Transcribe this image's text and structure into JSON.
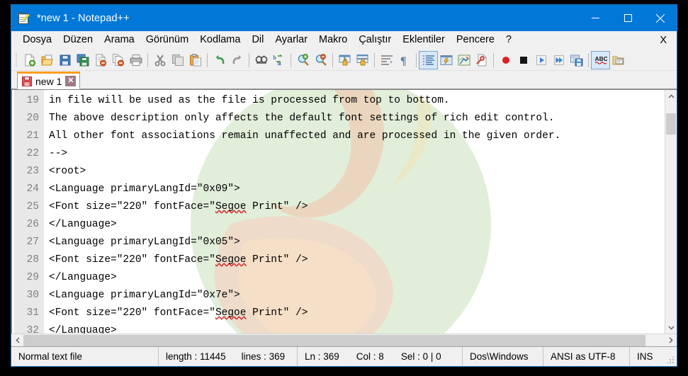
{
  "window": {
    "title": "*new  1 - Notepad++",
    "icon": "notepad-plus-plus-icon",
    "accent_color": "#0078d7",
    "controls": {
      "minimize": "minimize-icon",
      "maximize": "maximize-icon",
      "close": "close-icon"
    }
  },
  "menu": {
    "items": [
      {
        "label": "Dosya"
      },
      {
        "label": "Düzen"
      },
      {
        "label": "Arama"
      },
      {
        "label": "Görünüm"
      },
      {
        "label": "Kodlama"
      },
      {
        "label": "Dil"
      },
      {
        "label": "Ayarlar"
      },
      {
        "label": "Makro"
      },
      {
        "label": "Çalıştır"
      },
      {
        "label": "Eklentiler"
      },
      {
        "label": "Pencere"
      },
      {
        "label": "?"
      }
    ],
    "right_label": "X"
  },
  "toolbar": {
    "buttons": [
      {
        "name": "new-file-icon"
      },
      {
        "name": "open-file-icon"
      },
      {
        "name": "save-icon"
      },
      {
        "name": "save-all-icon"
      },
      {
        "name": "close-file-icon"
      },
      {
        "name": "close-all-files-icon"
      },
      {
        "name": "print-icon"
      },
      {
        "name": "cut-icon"
      },
      {
        "name": "copy-icon"
      },
      {
        "name": "paste-icon"
      },
      {
        "name": "undo-icon"
      },
      {
        "name": "redo-icon"
      },
      {
        "name": "find-icon"
      },
      {
        "name": "replace-icon"
      },
      {
        "name": "zoom-in-icon"
      },
      {
        "name": "zoom-out-icon"
      },
      {
        "name": "sync-vertical-scrolling-icon"
      },
      {
        "name": "sync-horizontal-scrolling-icon"
      },
      {
        "name": "word-wrap-icon"
      },
      {
        "name": "show-all-characters-icon"
      },
      {
        "name": "show-indent-guide-icon"
      },
      {
        "name": "user-defined-language-icon"
      },
      {
        "name": "document-map-icon"
      },
      {
        "name": "function-list-icon"
      },
      {
        "name": "start-record-macro-icon"
      },
      {
        "name": "stop-record-macro-icon"
      },
      {
        "name": "play-macro-icon"
      },
      {
        "name": "run-macro-multiple-times-icon"
      },
      {
        "name": "save-macro-icon"
      },
      {
        "name": "spell-check-icon"
      },
      {
        "name": "file-browser-icon"
      }
    ]
  },
  "tabs": [
    {
      "label": "new 1",
      "icon": "unsaved-file-icon",
      "close_label": "✕",
      "active": true,
      "modified": true
    }
  ],
  "editor": {
    "first_line_number": 19,
    "lines": [
      {
        "num": 19,
        "text": "in file will be used as the file is processed from top to bottom."
      },
      {
        "num": 20,
        "text": "The above description only affects the default font settings of rich edit control."
      },
      {
        "num": 21,
        "text": "All other font associations remain unaffected and are processed in the given order."
      },
      {
        "num": 22,
        "text": "-->"
      },
      {
        "num": 23,
        "text": "<root>"
      },
      {
        "num": 24,
        "text": "<Language primaryLangId=\"0x09\">"
      },
      {
        "num": 25,
        "text": "<Font size=\"220\" fontFace=\"Segoe Print\" />",
        "misspelled": "Segoe"
      },
      {
        "num": 26,
        "text": "</Language>"
      },
      {
        "num": 27,
        "text": "<Language primaryLangId=\"0x05\">"
      },
      {
        "num": 28,
        "text": "<Font size=\"220\" fontFace=\"Segoe Print\" />",
        "misspelled": "Segoe"
      },
      {
        "num": 29,
        "text": "</Language>"
      },
      {
        "num": 30,
        "text": "<Language primaryLangId=\"0x7e\">"
      },
      {
        "num": 31,
        "text": "<Font size=\"220\" fontFace=\"Segoe Print\" />",
        "misspelled": "Segoe"
      },
      {
        "num": 32,
        "text": "</Language>"
      }
    ],
    "watermark": "notepad-plus-plus-logo-watermark",
    "scrollbars": {
      "vertical_up": "chevron-up-icon",
      "vertical_down": "chevron-down-icon",
      "horizontal_left": "chevron-left-icon",
      "horizontal_right": "chevron-right-icon"
    }
  },
  "status_bar": {
    "doc_type": "Normal text file",
    "length_label": "length : 11445",
    "lines_label": "lines : 369",
    "ln_label": "Ln : 369",
    "col_label": "Col : 8",
    "sel_label": "Sel : 0 | 0",
    "eol": "Dos\\Windows",
    "encoding": "ANSI as UTF-8",
    "insert_mode": "INS"
  }
}
